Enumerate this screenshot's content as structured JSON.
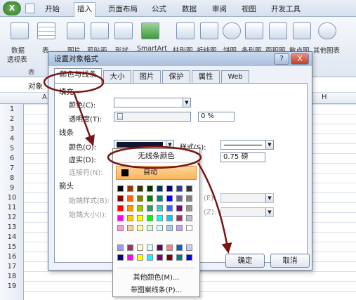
{
  "ribbon": {
    "tabs": [
      "开始",
      "插入",
      "页面布局",
      "公式",
      "数据",
      "审阅",
      "视图",
      "开发工具"
    ],
    "active_tab": "插入",
    "buttons": {
      "pivot_label_1": "数据",
      "pivot_label_2": "透视表",
      "table_label": "表",
      "picture_label": "图片",
      "clipart_label": "剪贴画",
      "shapes_label": "形状",
      "smartart_label": "SmartArt",
      "col_label": "柱形图",
      "line_label": "折线图",
      "pie_label": "饼图",
      "bar_label": "条形图",
      "area_label": "面积图",
      "scatter_label": "散点图",
      "other_label": "其他图表"
    },
    "groups": {
      "table_group": "表"
    }
  },
  "sheet": {
    "name_box_text": "对象",
    "col_letters": [
      "A",
      "H"
    ],
    "rows": [
      "1",
      "2",
      "3",
      "4",
      "5",
      "6",
      "7",
      "8",
      "9",
      "10",
      "11",
      "12",
      "13",
      "14",
      "15",
      "16",
      "17",
      "18",
      "19"
    ]
  },
  "dialog": {
    "title": "设置对象格式",
    "help_label": "?",
    "close_label": "X",
    "tabs": [
      "颜色与线条",
      "大小",
      "图片",
      "保护",
      "属性",
      "Web"
    ],
    "fill": {
      "section": "填充",
      "color_label": "颜色(C):",
      "transparency_label": "透明度(T):",
      "transparency_value": "0 %"
    },
    "line": {
      "section": "线条",
      "color_label": "颜色(O):",
      "dash_label": "虚实(D):",
      "connector_label": "连接符(N):",
      "style_label": "样式(S):",
      "weight_value": "0.75 磅"
    },
    "arrows": {
      "section": "箭头",
      "begin_style_label": "始端样式(B):",
      "begin_size_label": "始端大小(I):",
      "end_style_partial": "(E)",
      "end_size_partial": "(Z):"
    },
    "ok_label": "确定",
    "cancel_label": "取消"
  },
  "color_popup": {
    "no_line_label": "无线条颜色",
    "auto_label": "自动",
    "more_colors_label": "其他颜色(M)...",
    "patterned_lines_label": "带图案线条(P)...",
    "palette": [
      [
        "#000000",
        "#993300",
        "#333300",
        "#003300",
        "#003366",
        "#000080",
        "#333399",
        "#333333"
      ],
      [
        "#800000",
        "#FF6600",
        "#808000",
        "#008000",
        "#008080",
        "#0000FF",
        "#666699",
        "#808080"
      ],
      [
        "#FF0000",
        "#FF9900",
        "#99CC00",
        "#339966",
        "#33CCCC",
        "#3366FF",
        "#800080",
        "#969696"
      ],
      [
        "#FF00FF",
        "#FFCC00",
        "#FFFF00",
        "#00FF00",
        "#00FFFF",
        "#00CCFF",
        "#993366",
        "#C0C0C0"
      ],
      [
        "#FF99CC",
        "#FFCC99",
        "#FFFF99",
        "#CCFFCC",
        "#CCFFFF",
        "#99CCFF",
        "#CC99FF",
        "#FFFFFF"
      ]
    ],
    "palette_extra": [
      [
        "#9999FF",
        "#993366",
        "#FFFFCC",
        "#CCFFFF",
        "#660066",
        "#FF8080",
        "#0066CC",
        "#CCCCFF"
      ],
      [
        "#000080",
        "#FF00FF",
        "#FFFF00",
        "#00FFFF",
        "#800080",
        "#800000",
        "#008080",
        "#0000FF"
      ]
    ]
  },
  "colors": {
    "annotation": "#7a1414",
    "accent": "#fbb45c"
  }
}
